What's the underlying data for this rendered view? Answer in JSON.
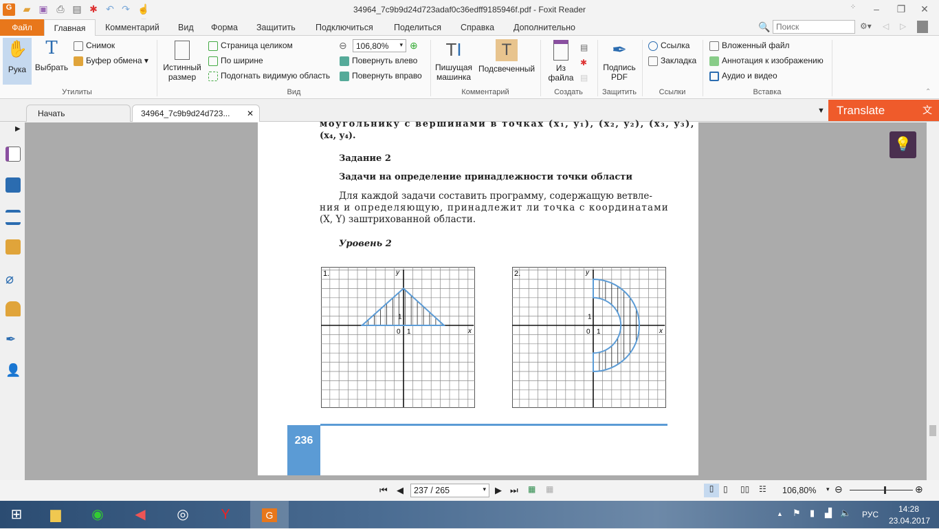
{
  "window": {
    "title": "34964_7c9b9d24d723adaf0c36edff9185946f.pdf - Foxit Reader"
  },
  "menu": {
    "file": "Файл",
    "tabs": [
      "Главная",
      "Комментарий",
      "Вид",
      "Форма",
      "Защитить",
      "Подключиться",
      "Поделиться",
      "Справка",
      "Дополнительно"
    ],
    "search_placeholder": "Поиск"
  },
  "ribbon": {
    "hand": "Рука",
    "select": "Выбрать",
    "snapshot": "Снимок",
    "clipboard": "Буфер обмена",
    "group_utils": "Утилиты",
    "actual_size_1": "Истинный",
    "actual_size_2": "размер",
    "fit_page": "Страница целиком",
    "fit_width": "По ширине",
    "fit_visible": "Подогнать видимую область",
    "zoom": "106,80%",
    "rotate_left": "Повернуть влево",
    "rotate_right": "Повернуть вправо",
    "group_view": "Вид",
    "typewriter_1": "Пишущая",
    "typewriter_2": "машинка",
    "highlight": "Подсвеченный",
    "group_comment": "Комментарий",
    "from_file_1": "Из",
    "from_file_2": "файла",
    "group_create": "Создать",
    "sign_1": "Подпись",
    "sign_2": "PDF",
    "group_protect": "Защитить",
    "link": "Ссылка",
    "bookmark": "Закладка",
    "group_links": "Ссылки",
    "attachment": "Вложенный файл",
    "image_annot": "Аннотация к изображению",
    "audio_video": "Аудио и видео",
    "group_insert": "Вставка"
  },
  "tabs": {
    "start": "Начать",
    "doc": "34964_7c9b9d24d723...",
    "translate": "Translate"
  },
  "page": {
    "line0": "моугольнику с вершинами в точках (x₁, y₁), (x₂, y₂), (x₃, y₃),",
    "line1": "(x₄, y₄).",
    "task": "Задание 2",
    "heading": "Задачи на определение принадлежности точки области",
    "para1": "Для каждой задачи составить программу, содержащую ветвле-",
    "para2": "ния и определяющую, принадлежит ли точка с координатами",
    "para3": "(X, Y) заштрихованной области.",
    "level": "Уровень 2",
    "fig1": "1.",
    "fig2": "2.",
    "x": "x",
    "y": "y",
    "zero": "0",
    "one": "1",
    "page_number": "236"
  },
  "status": {
    "page": "237 / 265",
    "zoom": "106,80%",
    "zoom_level": 0.55
  },
  "taskbar": {
    "lang": "РУС",
    "time": "14:28",
    "date": "23.04.2017"
  },
  "colors": {
    "accent": "#e8771b",
    "translate": "#ef5b2b",
    "figure": "#5b9bd5"
  }
}
